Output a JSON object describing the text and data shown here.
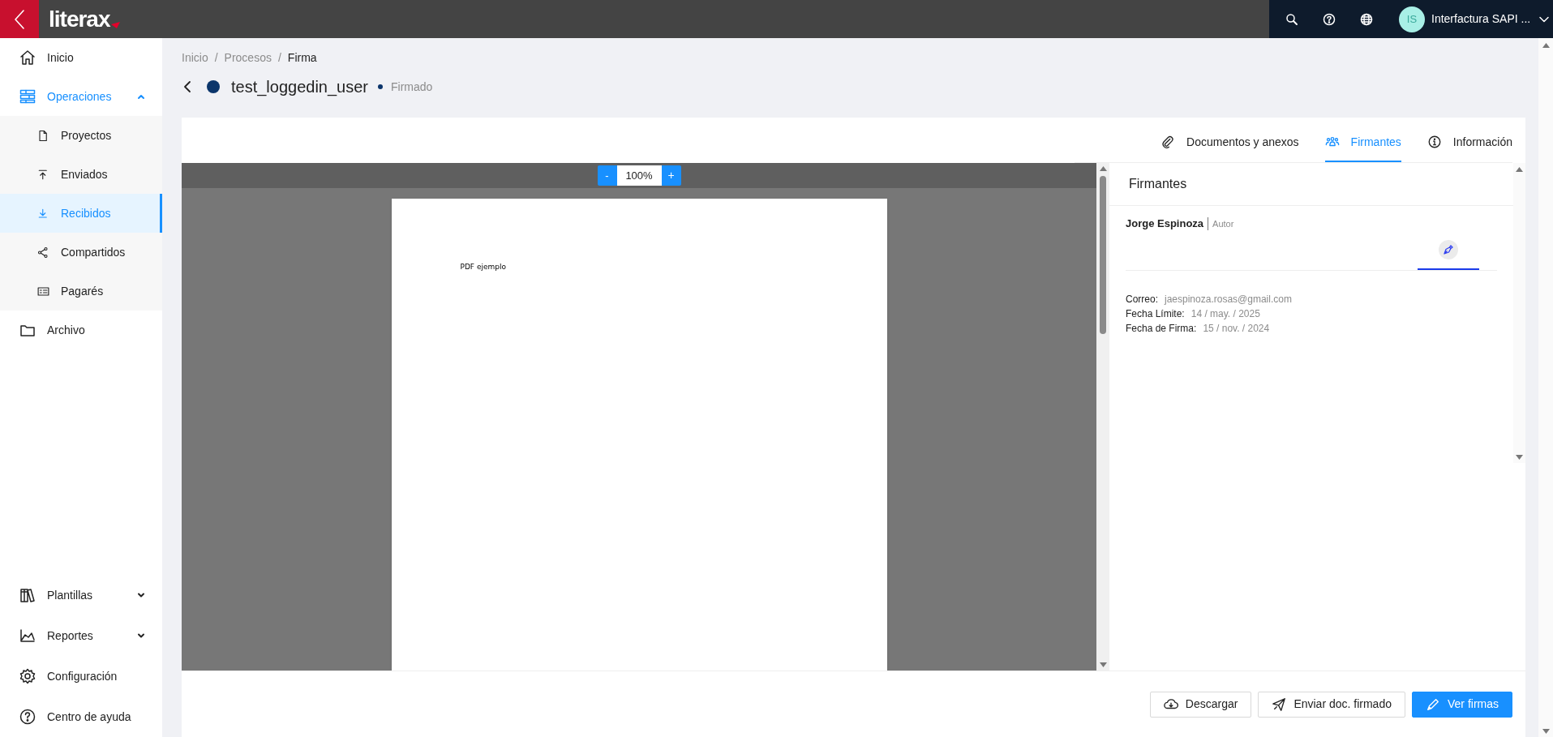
{
  "top_bar": {
    "logo": "literax",
    "user": {
      "initials": "IS",
      "name": "Interfactura SAPI ..."
    }
  },
  "sidebar": {
    "items": [
      {
        "label": "Inicio",
        "selected": false
      },
      {
        "label": "Operaciones",
        "selected": true,
        "expanded": true,
        "children": [
          {
            "label": "Proyectos",
            "selected": false
          },
          {
            "label": "Enviados",
            "selected": false
          },
          {
            "label": "Recibidos",
            "selected": true
          },
          {
            "label": "Compartidos",
            "selected": false
          },
          {
            "label": "Pagarés",
            "selected": false
          }
        ]
      },
      {
        "label": "Archivo",
        "selected": false
      }
    ],
    "bottom_items": [
      {
        "label": "Plantillas",
        "expanded": false
      },
      {
        "label": "Reportes",
        "expanded": false
      },
      {
        "label": "Configuración"
      },
      {
        "label": "Centro de ayuda"
      }
    ]
  },
  "breadcrumb": [
    {
      "label": "Inicio"
    },
    {
      "separator": "/",
      "label": "Procesos"
    },
    {
      "separator": "/",
      "label": "Firma"
    }
  ],
  "document": {
    "title": "test_loggedin_user",
    "status": "Firmado"
  },
  "tabs": [
    {
      "label": "Documentos y anexos",
      "selected": false
    },
    {
      "label": "Firmantes",
      "selected": true
    },
    {
      "label": "Información",
      "selected": false
    }
  ],
  "viewer": {
    "zoom_out": "-",
    "zoom": "100%",
    "zoom_in": "+",
    "page_text": "PDF ejemplo"
  },
  "signers_panel": {
    "title": "Firmantes",
    "signers": [
      {
        "name": "Jorge Espinoza",
        "role": "Autor",
        "fields": [
          {
            "label": "Correo:",
            "value": "jaespinoza.rosas@gmail.com"
          },
          {
            "label": "Fecha Límite:",
            "value": "14 / may. / 2025"
          },
          {
            "label": "Fecha de Firma:",
            "value": "15 / nov. / 2024"
          }
        ]
      }
    ]
  },
  "buttons": [
    {
      "label": "Descargar",
      "kind": "outline"
    },
    {
      "label": "Enviar doc. firmado",
      "kind": "outline"
    },
    {
      "label": "Ver firmas",
      "kind": "primary"
    }
  ]
}
